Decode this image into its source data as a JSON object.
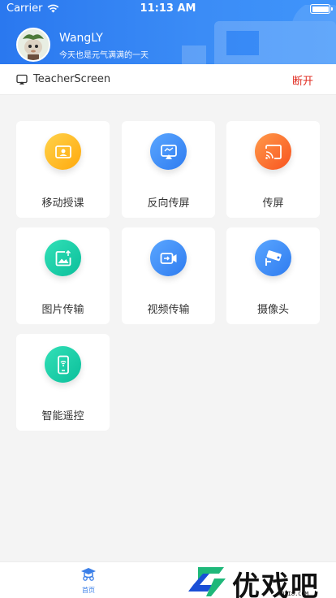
{
  "status_bar": {
    "carrier": "Carrier",
    "time": "11:13 AM"
  },
  "user": {
    "name": "WangLY",
    "motto": "今天也是元气满满的一天"
  },
  "screen": {
    "name": "TeacherScreen",
    "disconnect_label": "断开"
  },
  "features": [
    {
      "label": "移动授课",
      "icon": "mobile-teaching-icon",
      "color": "#ffba1a"
    },
    {
      "label": "反向传屏",
      "icon": "reverse-cast-icon",
      "color": "#3d8ef5"
    },
    {
      "label": "传屏",
      "icon": "cast-screen-icon",
      "color": "#fb6b2c"
    },
    {
      "label": "图片传输",
      "icon": "image-transfer-icon",
      "color": "#12c8a6"
    },
    {
      "label": "视频传输",
      "icon": "video-transfer-icon",
      "color": "#3d8ef5"
    },
    {
      "label": "摄像头",
      "icon": "camera-icon",
      "color": "#3d8ef5"
    },
    {
      "label": "智能遥控",
      "icon": "smart-remote-icon",
      "color": "#12c8a6"
    }
  ],
  "tabbar": {
    "home_label": "首页"
  },
  "watermark": {
    "text": "优戏吧",
    "url": "YOXI8.COM"
  },
  "colors": {
    "header": "#2f80f2",
    "disconnect": "#e02a1f",
    "tab_active": "#3b7fe8"
  }
}
